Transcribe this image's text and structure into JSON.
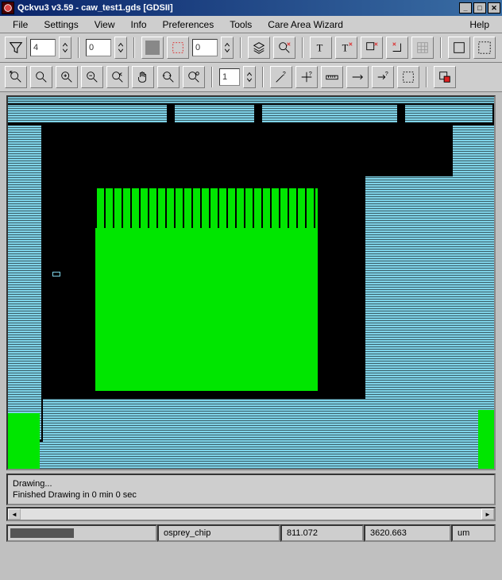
{
  "title": "Qckvu3 v3.59 - caw_test1.gds [GDSII]",
  "menu": {
    "file": "File",
    "settings": "Settings",
    "view": "View",
    "info": "Info",
    "preferences": "Preferences",
    "tools": "Tools",
    "care_area_wizard": "Care Area Wizard",
    "help": "Help"
  },
  "toolbar1": {
    "nesting_input": "4",
    "spin_input": "0",
    "swatch_color": "#888",
    "spin2_input": "0"
  },
  "toolbar2": {
    "scale_input": "1"
  },
  "status": {
    "line1": "Drawing...",
    "line2": "Finished Drawing in 0 min 0 sec"
  },
  "bottom": {
    "cell": "osprey_chip",
    "x": "811.072",
    "y": "3620.663",
    "units": "um"
  },
  "icons": {
    "filter": "filter-icon",
    "close": "close-icon"
  }
}
